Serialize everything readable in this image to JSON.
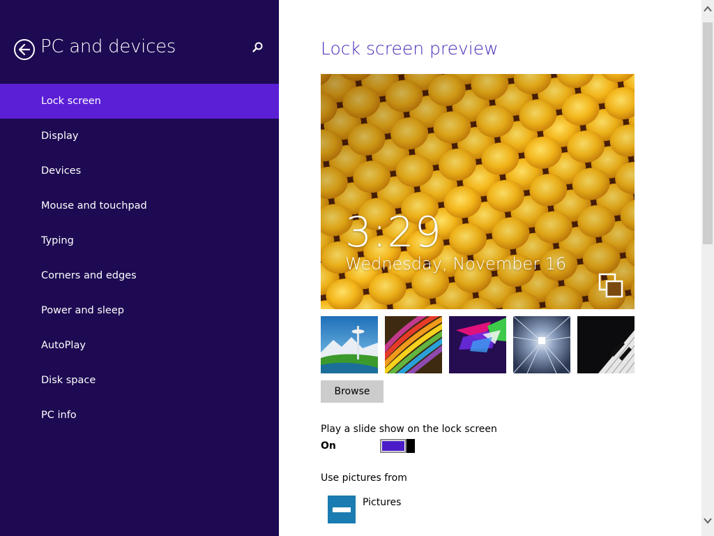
{
  "sidebar": {
    "title": "PC and devices",
    "items": [
      {
        "label": "Lock screen",
        "selected": true
      },
      {
        "label": "Display"
      },
      {
        "label": "Devices"
      },
      {
        "label": "Mouse and touchpad"
      },
      {
        "label": "Typing"
      },
      {
        "label": "Corners and edges"
      },
      {
        "label": "Power and sleep"
      },
      {
        "label": "AutoPlay"
      },
      {
        "label": "Disk space"
      },
      {
        "label": "PC info"
      }
    ]
  },
  "main": {
    "title": "Lock screen preview",
    "preview": {
      "time": "3:29",
      "date": "Wednesday, November 16"
    },
    "browse_label": "Browse",
    "slideshow": {
      "label": "Play a slide show on the lock screen",
      "state": "On",
      "enabled": true
    },
    "pictures_from": {
      "label": "Use pictures from",
      "folder": "Pictures"
    }
  },
  "icons": {
    "back": "back-arrow-icon",
    "search": "search-icon",
    "slideshow": "slideshow-icon",
    "folder": "pictures-folder-icon"
  },
  "colors": {
    "sidebar_bg": "#1d0a52",
    "selected_bg": "#5b1fd6",
    "accent": "#4a2ab8",
    "toggle_fill": "#4b1cc8"
  }
}
